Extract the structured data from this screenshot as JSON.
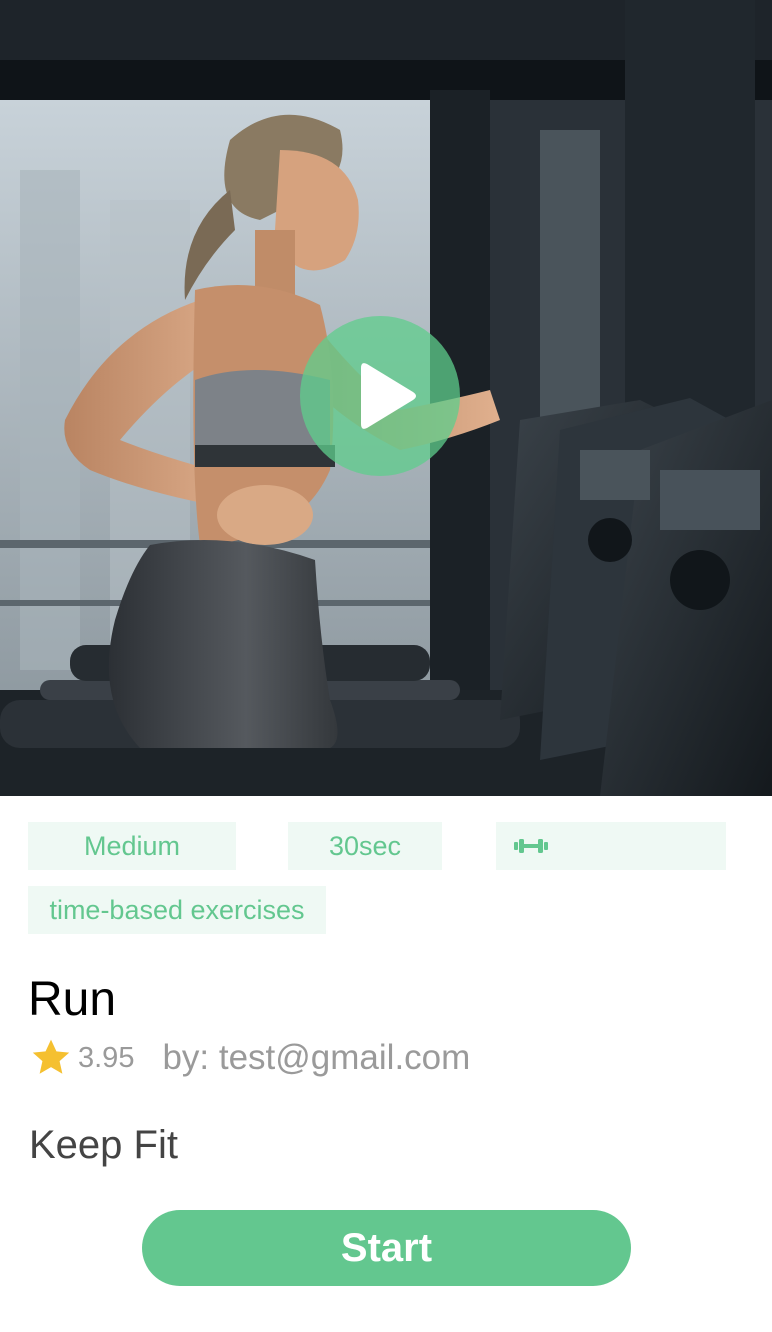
{
  "hero": {
    "image": "treadmill-workout-photo",
    "play_icon": "play-icon"
  },
  "tags": {
    "difficulty": "Medium",
    "duration": "30sec",
    "equipment_icon": "dumbbell-icon",
    "type": "time-based exercises"
  },
  "workout": {
    "title": "Run",
    "rating": "3.95",
    "author": "by: test@gmail.com",
    "description": "Keep Fit"
  },
  "actions": {
    "start_label": "Start"
  },
  "colors": {
    "accent": "#63c78f",
    "tag_background": "#eff9f4",
    "star": "#f5c030",
    "muted_text": "#9a9a9a"
  }
}
